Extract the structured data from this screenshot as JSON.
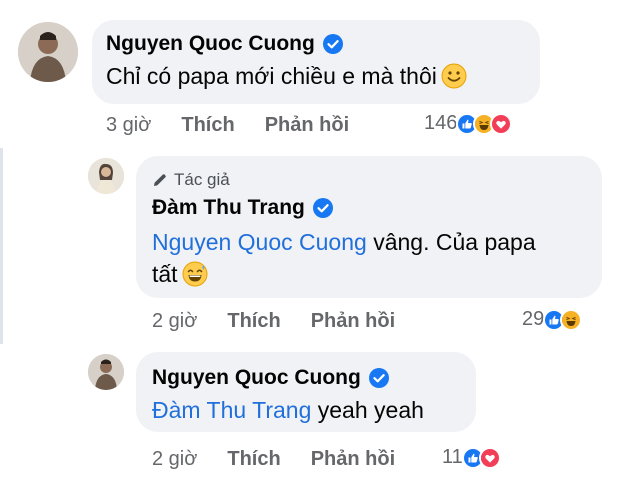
{
  "colors": {
    "bubble": "#f0f2f5",
    "mention": "#216fdb",
    "meta": "#65676b",
    "like": "#1877f2",
    "love": "#f33e58",
    "haha": "#f7b125"
  },
  "comments": [
    {
      "author": "Nguyen Quoc Cuong",
      "verified_icon": "verified-badge-icon",
      "text": "Chỉ có papa mới chiều e mà thôi",
      "emoji": "smiling-face-emoji",
      "time": "3 giờ",
      "like_label": "Thích",
      "reply_label": "Phản hồi",
      "reaction_count": "146",
      "reactions": [
        "like-reaction-icon",
        "haha-reaction-icon",
        "love-reaction-icon"
      ]
    },
    {
      "author_badge_icon": "pencil-icon",
      "author_badge": "Tác giả",
      "author": "Đàm Thu Trang",
      "verified_icon": "verified-badge-icon",
      "mention": "Nguyen Quoc Cuong",
      "text_line1": " vâng. Của papa",
      "text_line2": "tất",
      "emoji": "grinning-sweat-emoji",
      "time": "2 giờ",
      "like_label": "Thích",
      "reply_label": "Phản hồi",
      "reaction_count": "29",
      "reactions": [
        "like-reaction-icon",
        "haha-reaction-icon"
      ]
    },
    {
      "author": "Nguyen Quoc Cuong",
      "verified_icon": "verified-badge-icon",
      "mention": "Đàm Thu Trang",
      "text": " yeah yeah",
      "time": "2 giờ",
      "like_label": "Thích",
      "reply_label": "Phản hồi",
      "reaction_count": "11",
      "reactions": [
        "like-reaction-icon",
        "love-reaction-icon"
      ]
    }
  ]
}
